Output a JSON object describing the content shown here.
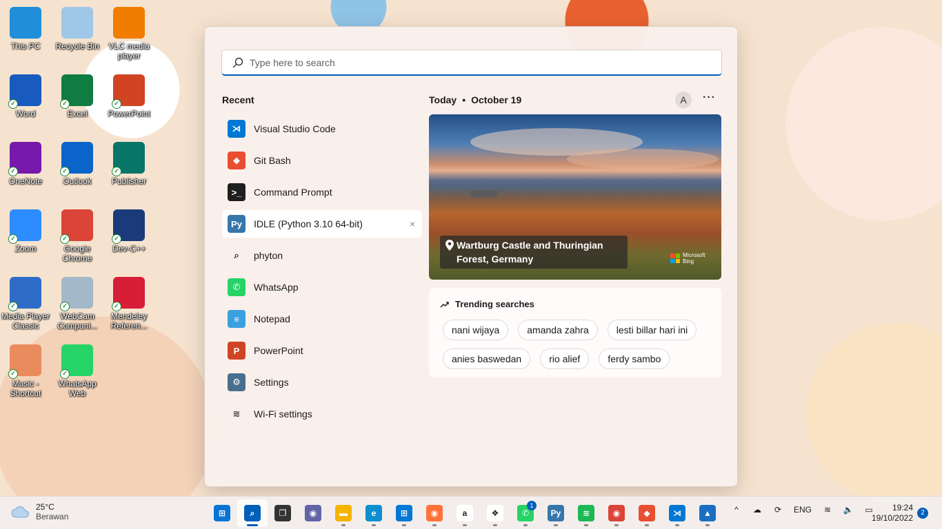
{
  "desktop": {
    "icons": [
      {
        "label": "This PC",
        "icon": "monitor-icon",
        "color": "#1e8fd8"
      },
      {
        "label": "Recycle Bin",
        "icon": "recycle-bin-icon",
        "color": "#9fc7e8"
      },
      {
        "label": "VLC media player",
        "icon": "vlc-cone-icon",
        "color": "#f07c00"
      },
      {
        "label": "Word",
        "icon": "word-icon",
        "color": "#185abd"
      },
      {
        "label": "Excel",
        "icon": "excel-icon",
        "color": "#107c41"
      },
      {
        "label": "PowerPoint",
        "icon": "powerpoint-icon",
        "color": "#d04423"
      },
      {
        "label": "OneNote",
        "icon": "onenote-icon",
        "color": "#7719aa"
      },
      {
        "label": "Outlook",
        "icon": "outlook-icon",
        "color": "#0a64c9"
      },
      {
        "label": "Publisher",
        "icon": "publisher-icon",
        "color": "#077568"
      },
      {
        "label": "Zoom",
        "icon": "zoom-icon",
        "color": "#2d8cff"
      },
      {
        "label": "Google Chrome",
        "icon": "chrome-icon",
        "color": "#db4437"
      },
      {
        "label": "Dev-C++",
        "icon": "devcpp-icon",
        "color": "#1b3a7a"
      },
      {
        "label": "Media Player Classic",
        "icon": "media-player-classic-icon",
        "color": "#2e6dc7"
      },
      {
        "label": "WebCam Compani...",
        "icon": "webcam-icon",
        "color": "#a3b8c9"
      },
      {
        "label": "Mendeley Referen...",
        "icon": "mendeley-icon",
        "color": "#d71e36"
      },
      {
        "label": "Music - Shortcut",
        "icon": "music-folder-icon",
        "color": "#e98b5c"
      },
      {
        "label": "WhatsApp Web",
        "icon": "whatsapp-icon",
        "color": "#25d366"
      }
    ]
  },
  "search": {
    "placeholder": "Type here to search",
    "value": ""
  },
  "recent": {
    "title": "Recent",
    "items": [
      {
        "label": "Visual Studio Code",
        "icon": "vscode-icon",
        "color": "#0078d4",
        "glyph": "⋊"
      },
      {
        "label": "Git Bash",
        "icon": "git-bash-icon",
        "color": "#e94e31",
        "glyph": "◆"
      },
      {
        "label": "Command Prompt",
        "icon": "command-prompt-icon",
        "color": "#1f1f1f",
        "glyph": ">_"
      },
      {
        "label": "IDLE (Python 3.10 64-bit)",
        "icon": "python-idle-icon",
        "color": "#3776ab",
        "glyph": "Py"
      },
      {
        "label": "phyton",
        "icon": "search-icon",
        "color": "#ffffff",
        "glyph": "⌕"
      },
      {
        "label": "WhatsApp",
        "icon": "whatsapp-icon",
        "color": "#25d366",
        "glyph": "✆"
      },
      {
        "label": "Notepad",
        "icon": "notepad-icon",
        "color": "#3aa0e0",
        "glyph": "≡"
      },
      {
        "label": "PowerPoint",
        "icon": "powerpoint-icon",
        "color": "#d04423",
        "glyph": "P"
      },
      {
        "label": "Settings",
        "icon": "gear-icon",
        "color": "#4a6e8e",
        "glyph": "⚙"
      },
      {
        "label": "Wi-Fi settings",
        "icon": "wifi-icon",
        "color": "#ffffff",
        "glyph": "≋"
      }
    ],
    "close_glyph": "×"
  },
  "today": {
    "label": "Today",
    "separator": "•",
    "date": "October 19",
    "avatar_letter": "A",
    "more_glyph": "···"
  },
  "hero": {
    "caption": "Wartburg Castle and Thuringian Forest, Germany",
    "brand_line1": "Microsoft",
    "brand_line2": "Bing"
  },
  "trending": {
    "title": "Trending searches",
    "chips": [
      "nani wijaya",
      "amanda zahra",
      "lesti billar hari ini",
      "anies baswedan",
      "rio alief",
      "ferdy sambo"
    ]
  },
  "taskbar": {
    "weather_temp": "25°C",
    "weather_desc": "Berawan",
    "apps": [
      {
        "icon": "windows-start-icon",
        "color": "#0a74d6",
        "glyph": "⊞",
        "active": false,
        "badge": ""
      },
      {
        "icon": "search-icon",
        "color": "#005fb8",
        "glyph": "⌕",
        "active": true,
        "badge": ""
      },
      {
        "icon": "task-view-icon",
        "color": "#333333",
        "glyph": "❐",
        "active": false,
        "badge": ""
      },
      {
        "icon": "teams-chat-icon",
        "color": "#6264a7",
        "glyph": "◉",
        "active": false,
        "badge": ""
      },
      {
        "icon": "file-explorer-icon",
        "color": "#f4b400",
        "glyph": "▬",
        "active": false,
        "badge": ""
      },
      {
        "icon": "edge-icon",
        "color": "#0c8fcf",
        "glyph": "e",
        "active": false,
        "badge": ""
      },
      {
        "icon": "microsoft-store-icon",
        "color": "#0078d4",
        "glyph": "⊞",
        "active": false,
        "badge": ""
      },
      {
        "icon": "firefox-icon",
        "color": "#ff7139",
        "glyph": "◉",
        "active": false,
        "badge": ""
      },
      {
        "icon": "amazon-icon",
        "color": "#ffffff",
        "glyph": "a",
        "active": false,
        "badge": ""
      },
      {
        "icon": "dropbox-icon",
        "color": "#ffffff",
        "glyph": "❖",
        "active": false,
        "badge": ""
      },
      {
        "icon": "whatsapp-icon",
        "color": "#25d366",
        "glyph": "✆",
        "active": false,
        "badge": "1"
      },
      {
        "icon": "python-icon",
        "color": "#3776ab",
        "glyph": "Py",
        "active": false,
        "badge": ""
      },
      {
        "icon": "spotify-icon",
        "color": "#1db954",
        "glyph": "≋",
        "active": false,
        "badge": ""
      },
      {
        "icon": "chrome-icon",
        "color": "#db4437",
        "glyph": "◉",
        "active": false,
        "badge": ""
      },
      {
        "icon": "git-icon",
        "color": "#e94e31",
        "glyph": "◆",
        "active": false,
        "badge": ""
      },
      {
        "icon": "vscode-icon",
        "color": "#0078d4",
        "glyph": "⋊",
        "active": false,
        "badge": ""
      },
      {
        "icon": "photos-icon",
        "color": "#1a6fc2",
        "glyph": "▲",
        "active": false,
        "badge": ""
      }
    ],
    "tray": {
      "chevron": "^",
      "cloud": "☁",
      "sync": "⟳",
      "language": "ENG",
      "wifi": "≋",
      "volume": "🔈",
      "battery": "▭"
    },
    "time": "19:24",
    "date": "19/10/2022",
    "notification_count": "2"
  }
}
